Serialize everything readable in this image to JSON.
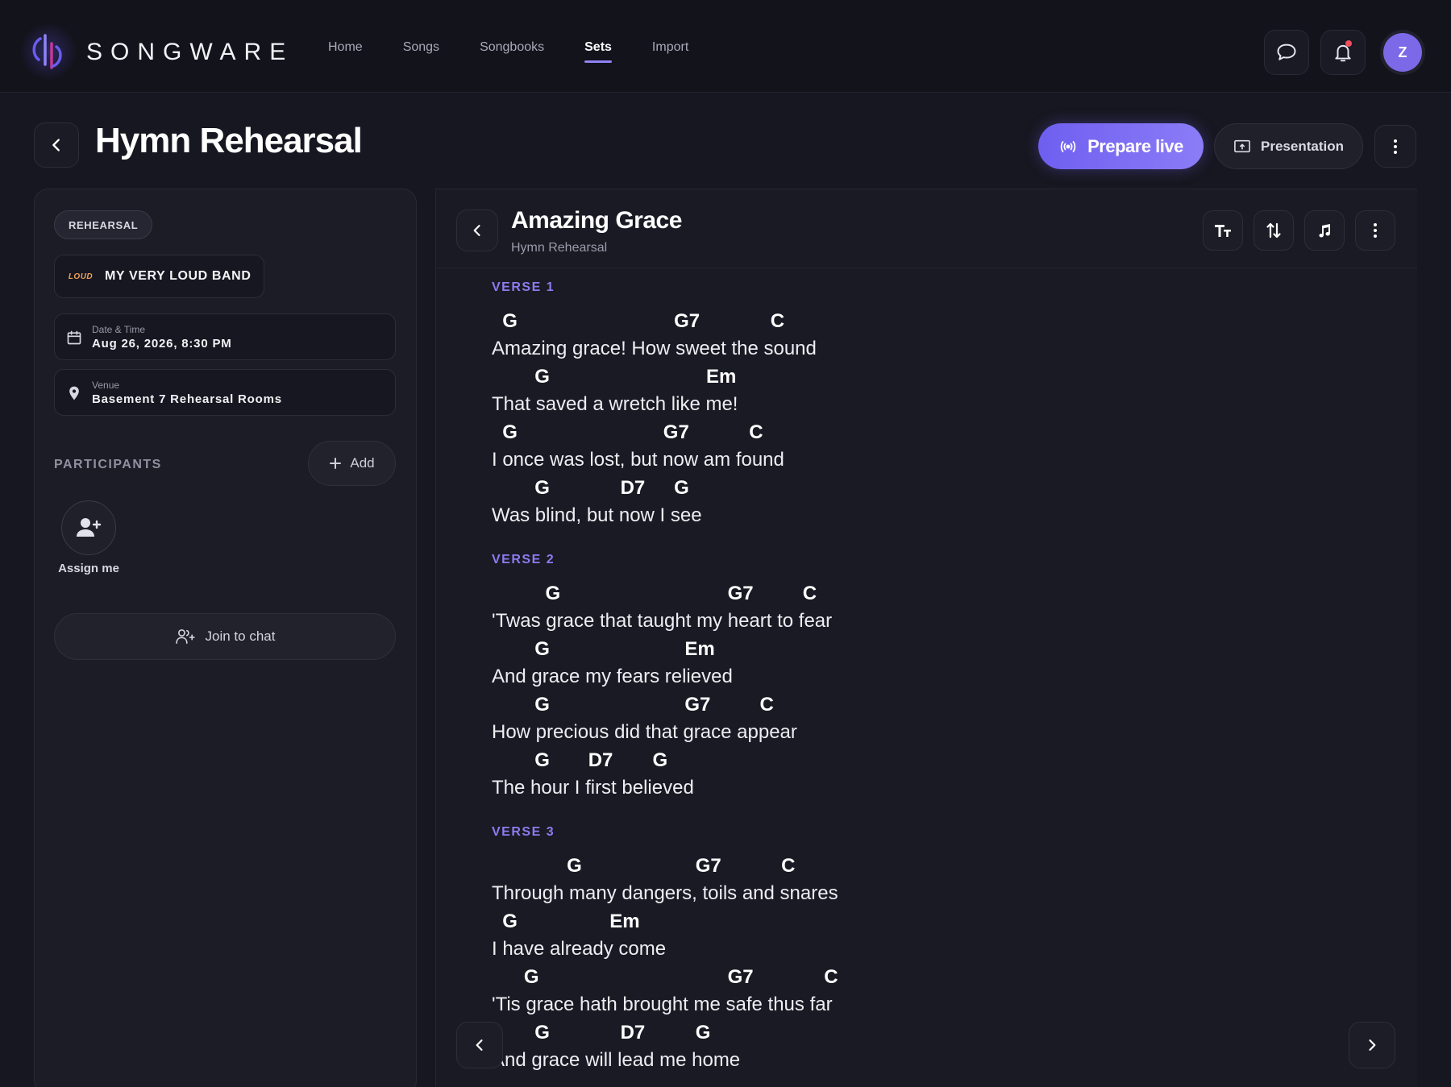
{
  "app": {
    "brand": "SONGWARE",
    "nav": [
      {
        "label": "Home",
        "active": false
      },
      {
        "label": "Songs",
        "active": false
      },
      {
        "label": "Songbooks",
        "active": false
      },
      {
        "label": "Sets",
        "active": true
      },
      {
        "label": "Import",
        "active": false
      }
    ],
    "user_initial": "Z",
    "accent_color": "#7c69e8",
    "notification_dot_color": "#f04e5e"
  },
  "header": {
    "title": "Hymn Rehearsal",
    "prepare_live_label": "Prepare live",
    "presentation_label": "Presentation"
  },
  "set": {
    "tag": "REHEARSAL",
    "band_logo_text": "LOUD",
    "band_name": "MY VERY LOUD BAND",
    "date_label": "Date & Time",
    "date_value": "Aug 26, 2026, 8:30 PM",
    "venue_label": "Venue",
    "venue_value": "Basement 7 Rehearsal Rooms",
    "participants_label": "PARTICIPANTS",
    "add_label": "Add",
    "assign_label": "Assign me",
    "join_chat_label": "Join to chat"
  },
  "song": {
    "title": "Amazing Grace",
    "subtitle": "Hymn Rehearsal",
    "verses": [
      {
        "label": "VERSE 1",
        "lines": [
          {
            "chords": [
              {
                "c": "G",
                "at": 1
              },
              {
                "c": "G7",
                "at": 17
              },
              {
                "c": "C",
                "at": 26
              }
            ],
            "text": "Amazing grace! How sweet the sound"
          },
          {
            "chords": [
              {
                "c": "G",
                "at": 4
              },
              {
                "c": "Em",
                "at": 20
              }
            ],
            "text": "That saved a wretch like me!"
          },
          {
            "chords": [
              {
                "c": "G",
                "at": 1
              },
              {
                "c": "G7",
                "at": 16
              },
              {
                "c": "C",
                "at": 24
              }
            ],
            "text": "I once was lost, but now am found"
          },
          {
            "chords": [
              {
                "c": "G",
                "at": 4
              },
              {
                "c": "D7",
                "at": 12
              },
              {
                "c": "G",
                "at": 17
              }
            ],
            "text": "Was blind, but now I see"
          }
        ]
      },
      {
        "label": "VERSE 2",
        "lines": [
          {
            "chords": [
              {
                "c": "G",
                "at": 5
              },
              {
                "c": "G7",
                "at": 22
              },
              {
                "c": "C",
                "at": 29
              }
            ],
            "text": "'Twas grace that taught my heart to fear"
          },
          {
            "chords": [
              {
                "c": "G",
                "at": 4
              },
              {
                "c": "Em",
                "at": 18
              }
            ],
            "text": "And grace my fears relieved"
          },
          {
            "chords": [
              {
                "c": "G",
                "at": 4
              },
              {
                "c": "G7",
                "at": 18
              },
              {
                "c": "C",
                "at": 25
              }
            ],
            "text": "How precious did that grace appear"
          },
          {
            "chords": [
              {
                "c": "G",
                "at": 4
              },
              {
                "c": "D7",
                "at": 9
              },
              {
                "c": "G",
                "at": 15
              }
            ],
            "text": "The hour I first believed"
          }
        ]
      },
      {
        "label": "VERSE 3",
        "lines": [
          {
            "chords": [
              {
                "c": "G",
                "at": 7
              },
              {
                "c": "G7",
                "at": 19
              },
              {
                "c": "C",
                "at": 27
              }
            ],
            "text": "Through many dangers, toils and snares"
          },
          {
            "chords": [
              {
                "c": "G",
                "at": 1
              },
              {
                "c": "Em",
                "at": 11
              }
            ],
            "text": "I have already come"
          },
          {
            "chords": [
              {
                "c": "G",
                "at": 3
              },
              {
                "c": "G7",
                "at": 22
              },
              {
                "c": "C",
                "at": 31
              }
            ],
            "text": "'Tis grace hath brought me safe thus far"
          },
          {
            "chords": [
              {
                "c": "G",
                "at": 4
              },
              {
                "c": "D7",
                "at": 12
              },
              {
                "c": "G",
                "at": 19
              }
            ],
            "text": "And grace will lead me home"
          }
        ]
      }
    ]
  }
}
